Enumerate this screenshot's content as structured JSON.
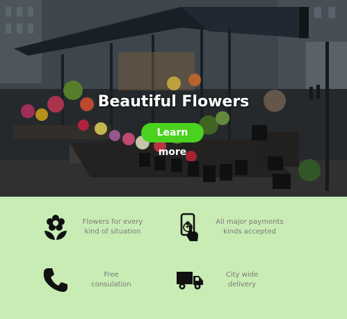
{
  "hero": {
    "title": "Beautiful Flowers",
    "cta_label": "Learn more"
  },
  "features": [
    {
      "icon": "flower-icon",
      "line1": "Flowers for every",
      "line2": "kind of situation"
    },
    {
      "icon": "mobile-payment-icon",
      "line1": "All major payments",
      "line2": "kinds accepted"
    },
    {
      "icon": "phone-icon",
      "line1": "Free consulation",
      "line2": ""
    },
    {
      "icon": "delivery-truck-icon",
      "line1": "City wide delivery",
      "line2": ""
    }
  ],
  "colors": {
    "accent": "#4bd21f",
    "features_bg": "#c8ecb4",
    "label_text": "#7a7a7a"
  }
}
